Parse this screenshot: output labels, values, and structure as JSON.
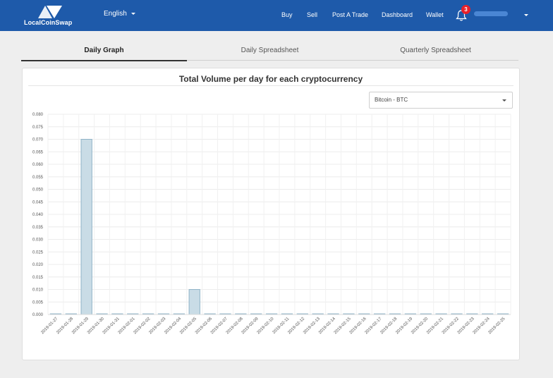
{
  "nav": {
    "brand": "LocalCoinSwap",
    "language": "English",
    "links": [
      "Buy",
      "Sell",
      "Post A Trade",
      "Dashboard",
      "Wallet"
    ],
    "notification_count": "3",
    "colors": {
      "bar": "#1e5aaa",
      "badge": "#e8212a"
    }
  },
  "tabs": [
    {
      "label": "Daily Graph",
      "active": true
    },
    {
      "label": "Daily Spreadsheet",
      "active": false
    },
    {
      "label": "Quarterly Spreadsheet",
      "active": false
    }
  ],
  "chart_card": {
    "title": "Total Volume per day for each cryptocurrency",
    "currency_select": "Bitcoin - BTC"
  },
  "chart_data": {
    "type": "bar",
    "title": "Total Volume per day for each cryptocurrency",
    "ylim": [
      0,
      0.08
    ],
    "yticks": [
      "0.000",
      "0.005",
      "0.010",
      "0.015",
      "0.020",
      "0.025",
      "0.030",
      "0.035",
      "0.040",
      "0.045",
      "0.050",
      "0.055",
      "0.060",
      "0.065",
      "0.070",
      "0.075",
      "0.080"
    ],
    "grid": true,
    "categories": [
      "2019-01-27",
      "2019-01-28",
      "2019-01-29",
      "2019-01-30",
      "2019-01-31",
      "2019-02-01",
      "2019-02-02",
      "2019-02-03",
      "2019-02-04",
      "2019-02-05",
      "2019-02-06",
      "2019-02-07",
      "2019-02-08",
      "2019-02-09",
      "2019-02-10",
      "2019-02-11",
      "2019-02-12",
      "2019-02-13",
      "2019-02-14",
      "2019-02-15",
      "2019-02-16",
      "2019-02-17",
      "2019-02-18",
      "2019-02-19",
      "2019-02-20",
      "2019-02-21",
      "2019-02-22",
      "2019-02-23",
      "2019-02-24",
      "2019-02-25"
    ],
    "values": [
      0,
      0,
      0.07,
      0,
      0,
      0,
      0,
      0,
      0,
      0.01,
      0,
      0,
      0,
      0,
      0,
      0,
      0,
      0,
      0,
      0,
      0,
      0,
      0,
      0,
      0,
      0,
      0,
      0,
      0,
      0
    ],
    "bar_fill": "#c9dce6",
    "bar_stroke": "#8fb3c7"
  }
}
